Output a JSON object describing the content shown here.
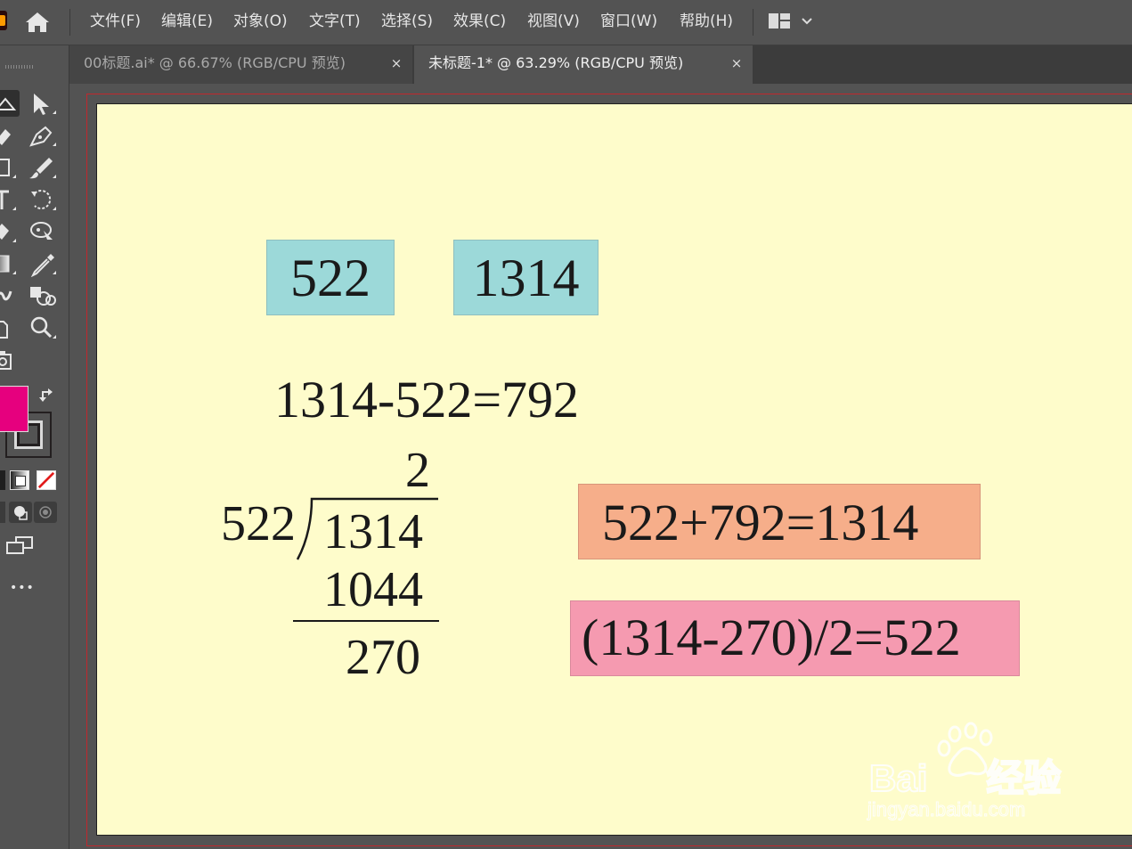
{
  "menu": {
    "items": [
      "文件(F)",
      "编辑(E)",
      "对象(O)",
      "文字(T)",
      "选择(S)",
      "效果(C)",
      "视图(V)",
      "窗口(W)",
      "帮助(H)"
    ]
  },
  "tabs": [
    {
      "label": "00标题.ai* @ 66.67% (RGB/CPU 预览)",
      "close": "×",
      "active": false
    },
    {
      "label": "未标题-1* @ 63.29% (RGB/CPU 预览)",
      "close": "×",
      "active": true
    }
  ],
  "toolbar": {
    "fill_color": "#e6007e",
    "stroke_color": "#231f20",
    "more_label": "•••"
  },
  "artboard": {
    "background": "#fefccb",
    "box_a": {
      "text": "522",
      "color": "#9cd9d9"
    },
    "box_b": {
      "text": "1314",
      "color": "#9cd9d9"
    },
    "subtraction": "1314-522=792",
    "division": {
      "quotient": "2",
      "divisor": "522",
      "dividend": "1314",
      "product": "1044",
      "remainder": "270"
    },
    "eq_add": {
      "text": "522+792=1314",
      "color": "#f6ae8a"
    },
    "eq_div": {
      "text": "(1314-270)/2=522",
      "color": "#f59ab0"
    }
  },
  "watermark": {
    "brand": "Bai",
    "brand_suffix": "经验",
    "url": "jingyan.baidu.com"
  }
}
